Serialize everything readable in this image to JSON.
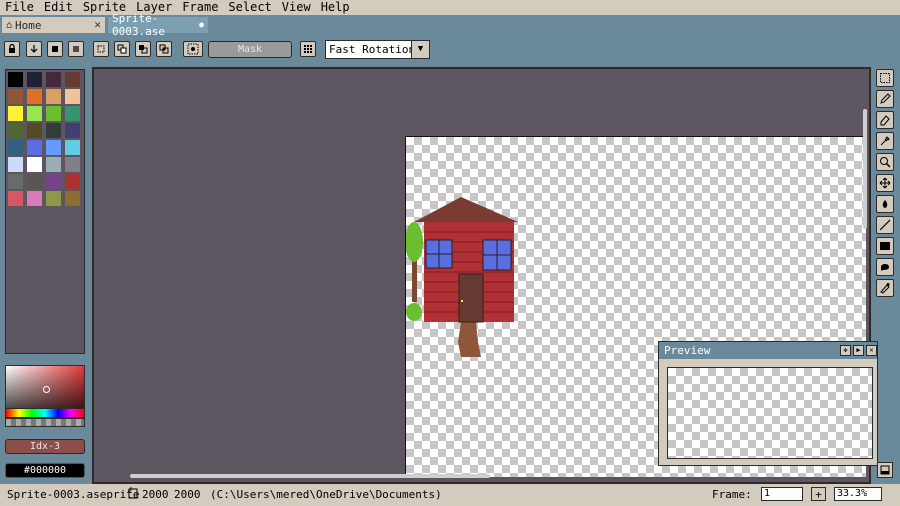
{
  "menu": [
    "File",
    "Edit",
    "Sprite",
    "Layer",
    "Frame",
    "Select",
    "View",
    "Help"
  ],
  "tabs": {
    "home": "Home",
    "sprite": "Sprite-0003.ase",
    "close_glyph": "✕",
    "modified_glyph": "●"
  },
  "toolbar": {
    "mask_label": "Mask",
    "rotation_value": "Fast Rotation",
    "icons": [
      "lock-icon",
      "down-arrow-icon",
      "fill-square-icon",
      "list-icon",
      "selection-replace-icon",
      "selection-add-icon",
      "selection-subtract-icon",
      "selection-intersect-icon",
      "pivot-icon",
      "grid-icon"
    ]
  },
  "palette": {
    "colors": [
      "#000000",
      "#222034",
      "#45283c",
      "#663931",
      "#8f563b",
      "#df7126",
      "#d9a066",
      "#eec39a",
      "#fbf236",
      "#99e550",
      "#6abe30",
      "#37946e",
      "#4b692f",
      "#524b24",
      "#323c39",
      "#3f3f74",
      "#306082",
      "#5b6ee1",
      "#639bff",
      "#5fcde4",
      "#cbdbfc",
      "#ffffff",
      "#9badb7",
      "#847e87",
      "#696a6a",
      "#595652",
      "#76428a",
      "#ac3232",
      "#d95763",
      "#d77bba",
      "#8f974a",
      "#8a6f30"
    ]
  },
  "color": {
    "index_label": "Idx-3",
    "hex_label": "#000000"
  },
  "preview": {
    "title": "Preview"
  },
  "tools": [
    "rectangle-select-icon",
    "pencil-icon",
    "eraser-icon",
    "eyedropper-icon",
    "zoom-icon",
    "move-icon",
    "paint-bucket-icon",
    "line-icon",
    "rectangle-icon",
    "contour-icon",
    "blur-icon"
  ],
  "status": {
    "filename": "Sprite-0003.aseprite",
    "width": "2000",
    "height": "2000",
    "path": "(C:\\Users\\mered\\OneDrive\\Documents)",
    "frame_label": "Frame:",
    "frame_value": "1",
    "plus": "+",
    "zoom_value": "33.3%"
  },
  "colors": {
    "chrome": "#6a8a9b",
    "panel": "#d3cbbd",
    "editor_bg": "#5d5560",
    "house_wall": "#b03034",
    "house_roof": "#7a3b34",
    "window": "#5b6ee1"
  }
}
